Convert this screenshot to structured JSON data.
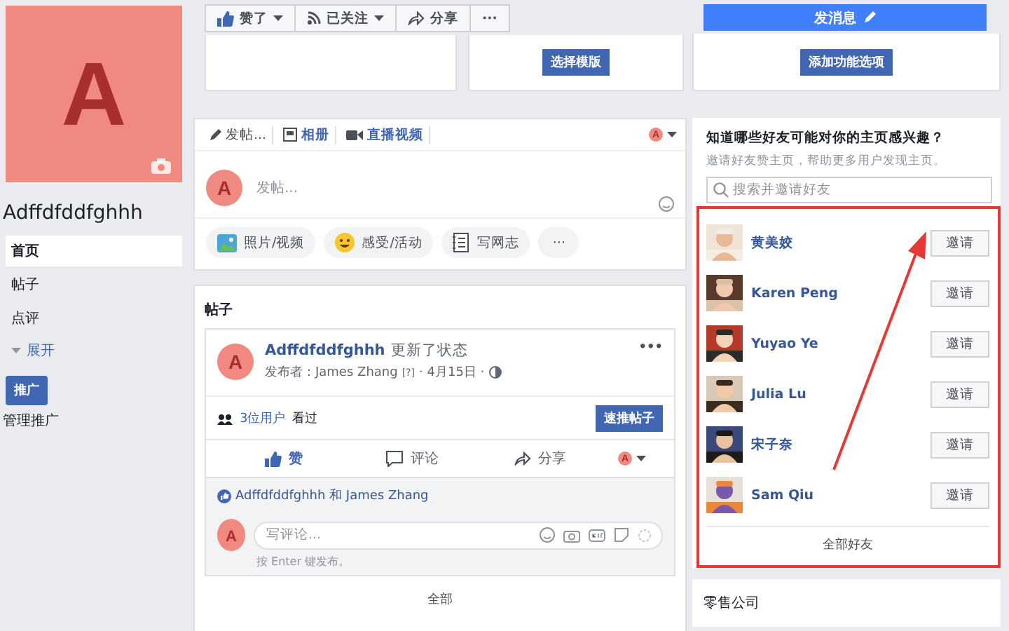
{
  "page": {
    "name": "Adffdfddfghhh",
    "cover_letter": "A"
  },
  "nav": [
    {
      "label": "首页",
      "selected": true
    },
    {
      "label": "帖子",
      "selected": false
    },
    {
      "label": "点评",
      "selected": false
    }
  ],
  "expand": "展开",
  "promote_button": "推广",
  "manage_link": "管理推广",
  "page_actions": [
    {
      "label": "赞了",
      "dropdown": true
    },
    {
      "label": "已关注",
      "dropdown": true
    },
    {
      "label": "分享",
      "dropdown": false
    },
    {
      "label": "···",
      "dropdown": false
    }
  ],
  "send_message": "发消息",
  "setup_buttons": [
    "选择模版",
    "添加功能选项"
  ],
  "composer": {
    "tabs": [
      {
        "label": "发帖...",
        "selected": true
      },
      {
        "label": "相册",
        "selected": false
      },
      {
        "label": "直播视频",
        "selected": false
      }
    ],
    "tab_avatar": "A",
    "avatar": "A",
    "placeholder": "发帖...",
    "actions": [
      "照片/视频",
      "感受/活动",
      "写网志"
    ],
    "more": "···"
  },
  "posts": {
    "title": "帖子",
    "post": {
      "avatar": "A",
      "author": "Adffdfddfghhh",
      "action": "更新了状态",
      "byline": "发布者：James Zhang",
      "help": "[?]",
      "date": "· 4月15日 ·",
      "more": "•••",
      "seen_count": "3位用户",
      "seen_text": "看过",
      "boost": "速推帖子",
      "reactions": [
        {
          "label": "赞",
          "selected": true
        },
        {
          "label": "评论",
          "selected": false
        },
        {
          "label": "分享",
          "selected": false
        }
      ],
      "reaction_avatar": "A",
      "likers": "Adffdfddfghhh 和 James Zhang",
      "comment_avatar": "A",
      "comment_placeholder": "写评论...",
      "comment_hint": "按 Enter 键发布。"
    },
    "see_all": "全部"
  },
  "invite": {
    "title": "知道哪些好友可能对你的主页感兴趣？",
    "subtitle": "邀请好友赞主页，帮助更多用户发现主页。",
    "search_placeholder": "搜索并邀请好友",
    "friends": [
      {
        "name": "黄美姣",
        "button": "邀请"
      },
      {
        "name": "Karen Peng",
        "button": "邀请"
      },
      {
        "name": "Yuyao Ye",
        "button": "邀请"
      },
      {
        "name": "Julia Lu",
        "button": "邀请"
      },
      {
        "name": "宋子奈",
        "button": "邀请"
      },
      {
        "name": "Sam Qiu",
        "button": "邀请"
      }
    ],
    "see_all": "全部好友"
  },
  "category": "零售公司"
}
